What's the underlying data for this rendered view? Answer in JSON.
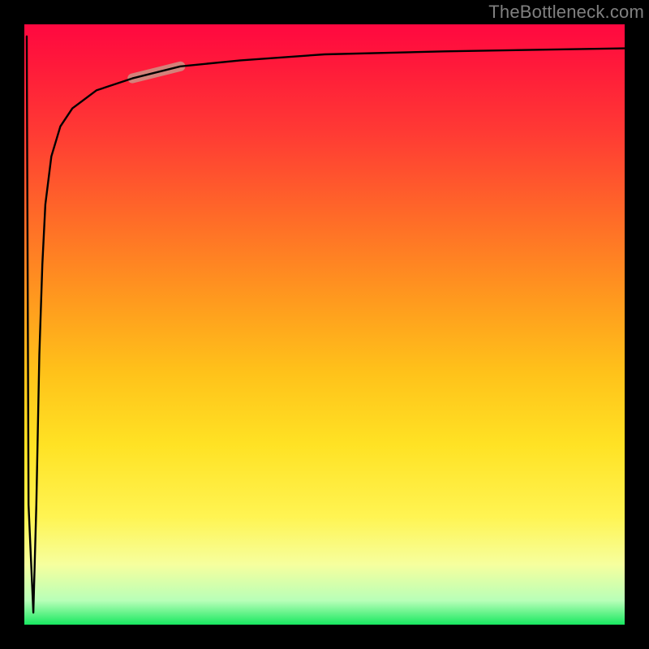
{
  "watermark": "TheBottleneck.com",
  "chart_data": {
    "type": "line",
    "title": "",
    "xlabel": "",
    "ylabel": "",
    "xlim": [
      0,
      100
    ],
    "ylim": [
      0,
      100
    ],
    "grid": false,
    "legend": false,
    "background_gradient": {
      "top": "#ff0840",
      "middle": "#ffe224",
      "bottom": "#18e860"
    },
    "series": [
      {
        "name": "bottleneck-curve",
        "color": "#000000",
        "x": [
          0.4,
          0.7,
          1.5,
          2.0,
          2.5,
          3.0,
          3.5,
          4.5,
          6.0,
          8.0,
          12,
          18,
          26,
          36,
          50,
          70,
          100
        ],
        "y": [
          98,
          20,
          2,
          20,
          45,
          60,
          70,
          78,
          83,
          86,
          89,
          91,
          93,
          94,
          95,
          95.5,
          96
        ]
      }
    ],
    "highlight_segment": {
      "series": "bottleneck-curve",
      "x_range": [
        18,
        26
      ],
      "color": "#d08a80"
    }
  }
}
